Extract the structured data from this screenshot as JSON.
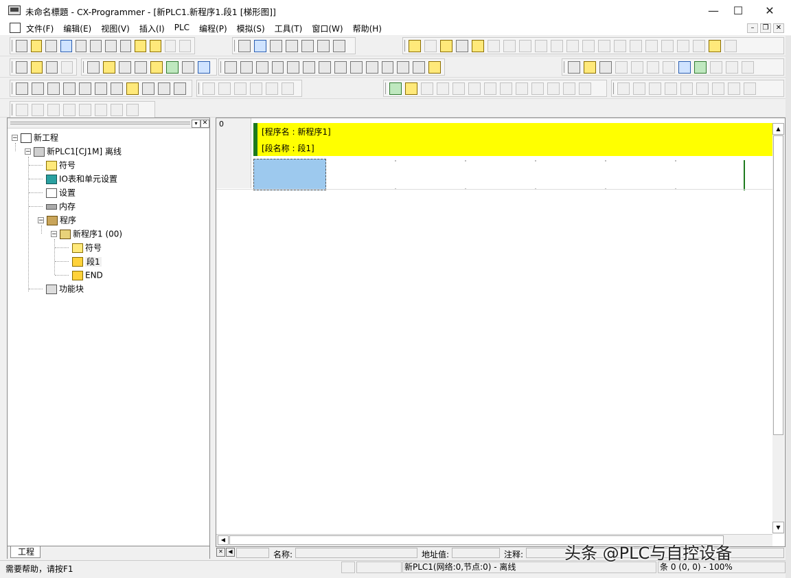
{
  "window": {
    "title": "未命名標題 - CX-Programmer - [新PLC1.新程序1.段1 [梯形图]]",
    "controls": {
      "minimize": "—",
      "maximize": "☐",
      "close": "✕"
    }
  },
  "menu": {
    "items": [
      "文件(F)",
      "编辑(E)",
      "视图(V)",
      "插入(I)",
      "PLC",
      "编程(P)",
      "模拟(S)",
      "工具(T)",
      "窗口(W)",
      "帮助(H)"
    ],
    "mdi_controls": {
      "minimize": "–",
      "restore": "❐",
      "close": "✕"
    }
  },
  "project_tree": {
    "tab_label": "工程",
    "nodes": [
      {
        "label": "新工程",
        "icon": "project-tree-icon"
      },
      {
        "label": "新PLC1[CJ1M] 离线",
        "icon": "plc-icon"
      },
      {
        "label": "符号",
        "icon": "symbols-icon"
      },
      {
        "label": "IO表和单元设置",
        "icon": "io-table-icon"
      },
      {
        "label": "设置",
        "icon": "settings-icon"
      },
      {
        "label": "内存",
        "icon": "memory-icon"
      },
      {
        "label": "程序",
        "icon": "programs-icon"
      },
      {
        "label": "新程序1 (00)",
        "icon": "program-icon"
      },
      {
        "label": "符号",
        "icon": "symbols-icon"
      },
      {
        "label": "段1",
        "icon": "section-icon"
      },
      {
        "label": "END",
        "icon": "section-icon"
      },
      {
        "label": "功能块",
        "icon": "function-block-icon"
      }
    ]
  },
  "ladder": {
    "rung_number": "0",
    "program_name_line": "[程序名 : 新程序1]",
    "section_name_line": "[段名称 : 段1]"
  },
  "info_bar": {
    "name_label": "名称:",
    "address_label": "地址值:",
    "comment_label": "注释:"
  },
  "status_bar": {
    "help_text": "需要帮助，请按F1",
    "plc_status": "新PLC1(网络:0,节点:0) - 离线",
    "position": "条 0 (0, 0)  - 100%"
  },
  "watermark": "头条 @PLC与自控设备",
  "colors": {
    "comment_bg": "#ffff00",
    "comment_bar": "#1e7a1e",
    "cursor_cell": "#9dc9ee"
  }
}
